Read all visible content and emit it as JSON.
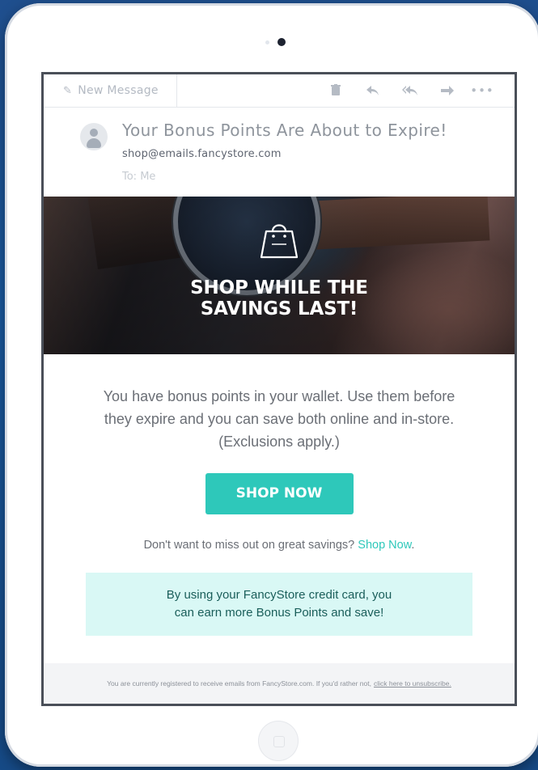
{
  "toolbar": {
    "new_message_label": "New Message",
    "icons": [
      "pencil-icon",
      "trash-icon",
      "reply-icon",
      "reply-all-icon",
      "forward-icon",
      "more-icon"
    ]
  },
  "email": {
    "subject": "Your Bonus Points Are About to Expire!",
    "sender": "shop@emails.fancystore.com",
    "recipient": "To: Me"
  },
  "hero": {
    "title_line1": "SHOP WHILE THE",
    "title_line2": "SAVINGS LAST!",
    "icon": "shopping-bag-icon"
  },
  "body": {
    "message": "You have bonus points in your wallet. Use them before they expire and you can save both online and in-store. (Exclusions apply.)",
    "cta_label": "SHOP NOW",
    "secondary_text": "Don't want to miss out on great savings?",
    "secondary_link": "Shop Now",
    "secondary_period": ".",
    "promo_line1": "By using your FancyStore credit card, you",
    "promo_line2": "can earn more Bonus Points and save!"
  },
  "footer": {
    "text": "You are currently registered to receive emails from FancyStore.com. If you'd rather not,",
    "unsubscribe_link": "click here to unsubscribe."
  },
  "colors": {
    "accent": "#2ec8ba",
    "promo_background": "#d9f8f5",
    "promo_text": "#1a5e5a",
    "background": "#1a5aa0"
  }
}
